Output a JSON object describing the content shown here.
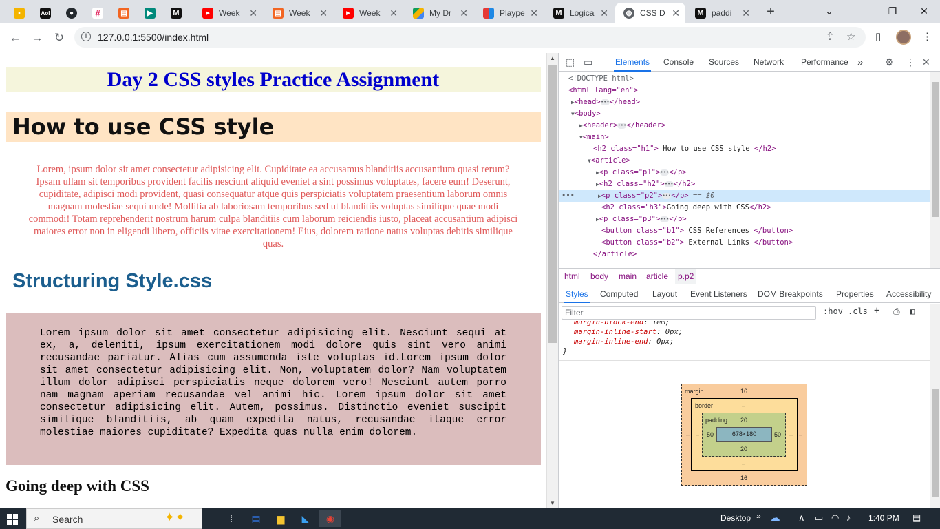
{
  "browser": {
    "tabs": [
      {
        "label": "",
        "icon": "keep-icon",
        "pinned": true
      },
      {
        "label": "",
        "icon": "aol-icon",
        "pinned": true
      },
      {
        "label": "",
        "icon": "github-icon",
        "pinned": true
      },
      {
        "label": "",
        "icon": "slack-icon",
        "pinned": true
      },
      {
        "label": "",
        "icon": "notes-icon",
        "pinned": true
      },
      {
        "label": "",
        "icon": "meet-icon",
        "pinned": true
      },
      {
        "label": "",
        "icon": "medium-icon",
        "pinned": true
      },
      {
        "label": "Week",
        "icon": "youtube-icon"
      },
      {
        "label": "Week",
        "icon": "notes-icon"
      },
      {
        "label": "Week",
        "icon": "youtube-icon"
      },
      {
        "label": "My Dr",
        "icon": "drive-icon"
      },
      {
        "label": "Plaype",
        "icon": "playpen-icon"
      },
      {
        "label": "Logica",
        "icon": "medium-icon"
      },
      {
        "label": "CSS D",
        "icon": "globe-icon",
        "active": true
      },
      {
        "label": "paddi",
        "icon": "medium-icon"
      }
    ],
    "url": "127.0.0.1:5500/index.html"
  },
  "page": {
    "h1": "Day 2 CSS styles Practice Assignment",
    "h2_title": "How to use CSS style",
    "p1": "Lorem, ipsum dolor sit amet consectetur adipisicing elit. Cupiditate ea accusamus blanditiis accusantium quasi rerum? Ipsam ullam sit temporibus provident facilis nesciunt aliquid eveniet a sint possimus voluptates, facere eum! Deserunt, cupiditate, adipisci modi provident, quasi consequatur atque quis perspiciatis voluptatem praesentium laborum omnis magnam molestiae sequi unde! Mollitia ab laboriosam temporibus sed ut blanditiis voluptas similique quae modi commodi! Totam reprehenderit nostrum harum culpa blanditiis cum laborum reiciendis iusto, placeat accusantium adipisci maiores error non in eligendi libero, officiis vitae exercitationem! Eius, dolorem ratione natus voluptas debitis similique quas.",
    "h2_struct": "Structuring Style.css",
    "p2": "Lorem ipsum dolor sit amet consectetur adipisicing elit. Nesciunt sequi at ex, a, deleniti, ipsum exercitationem modi dolore quis sint vero animi recusandae pariatur. Alias cum assumenda iste voluptas id.Lorem ipsum dolor sit amet consectetur adipisicing elit. Non, voluptatem dolor? Nam voluptatem illum dolor adipisci perspiciatis neque dolorem vero! Nesciunt autem porro nam magnam aperiam recusandae vel animi hic. Lorem ipsum dolor sit amet consectetur adipisicing elit. Autem, possimus. Distinctio eveniet suscipit similique blanditiis, ab quam expedita natus, recusandae itaque error molestiae maiores cupiditate? Expedita quas nulla enim dolorem.",
    "h3": "Going deep with CSS"
  },
  "devtools": {
    "tabs": [
      "Elements",
      "Console",
      "Sources",
      "Network",
      "Performance"
    ],
    "more": "»",
    "dom": {
      "doctype": "<!DOCTYPE html>",
      "html_open": "<html lang=\"en\">",
      "head": "<head>",
      "head_close": "</head>",
      "body": "<body>",
      "header": "<header>",
      "header_close": "</header>",
      "main": "<main>",
      "h2_h1_tag": "<h2 class=\"h1\">",
      "h2_h1_text": " How to use CSS style ",
      "h2_close": "</h2>",
      "article": "<article>",
      "p1_tag": "<p class=\"p1\">",
      "p_close": "</p>",
      "h2_h2_tag": "<h2 class=\"h2\">",
      "p2_tag": "<p class=\"p2\">",
      "sel_marker": "== $0",
      "h2_h3_tag": "<h2 class=\"h3\">",
      "h2_h3_text": "Going deep with CSS",
      "p3_tag": "<p class=\"p3\">",
      "b1_tag": "<button class=\"b1\">",
      "b1_text": " CSS References ",
      "b2_tag": "<button class=\"b2\">",
      "b2_text": " External Links ",
      "button_close": "</button>",
      "article_close": "</article>"
    },
    "crumbs": [
      "html",
      "body",
      "main",
      "article",
      "p.p2"
    ],
    "styles_tabs": [
      "Styles",
      "Computed",
      "Layout",
      "Event Listeners",
      "DOM Breakpoints",
      "Properties",
      "Accessibility"
    ],
    "filter_placeholder": "Filter",
    "hov": ":hov",
    "cls": ".cls",
    "rules": [
      {
        "prop": "margin-block-end",
        "value": "1em;"
      },
      {
        "prop": "margin-inline-start",
        "value": "0px;"
      },
      {
        "prop": "margin-inline-end",
        "value": "0px;"
      }
    ],
    "brace": "}",
    "boxmodel": {
      "margin_label": "margin",
      "margin_top": "16",
      "margin_bottom": "16",
      "margin_left": "–",
      "margin_right": "–",
      "border_label": "border",
      "border_top": "–",
      "border_bottom": "–",
      "border_left": "–",
      "border_right": "–",
      "padding_label": "padding",
      "padding_top": "20",
      "padding_bottom": "20",
      "padding_left": "50",
      "padding_right": "50",
      "content": "678×180"
    }
  },
  "taskbar": {
    "search": "Search",
    "desktop": "Desktop",
    "chevron": "»",
    "time": "1:40 PM"
  }
}
